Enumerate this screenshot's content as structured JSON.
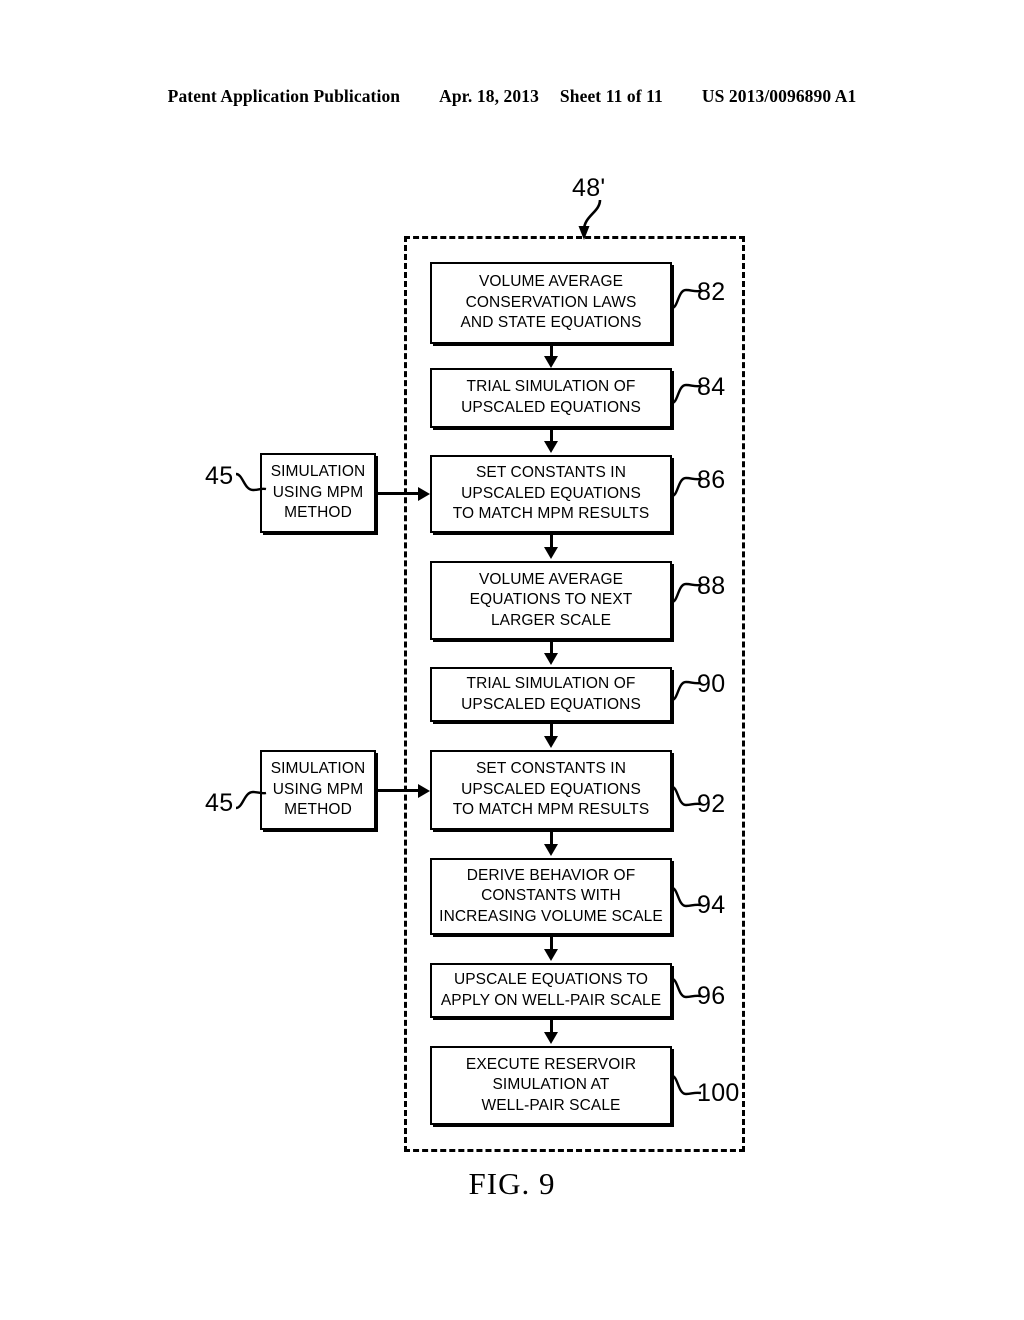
{
  "header": {
    "publication": "Patent Application Publication",
    "date": "Apr. 18, 2013",
    "sheet": "Sheet 11 of 11",
    "docnum": "US 2013/0096890 A1"
  },
  "figure": {
    "caption": "FIG. 9",
    "container_ref": "48'",
    "boxes": [
      {
        "ref": "82",
        "lines": [
          "VOLUME AVERAGE",
          "CONSERVATION LAWS",
          "AND STATE EQUATIONS"
        ]
      },
      {
        "ref": "84",
        "lines": [
          "TRIAL SIMULATION OF",
          "UPSCALED EQUATIONS"
        ]
      },
      {
        "ref": "86",
        "lines": [
          "SET CONSTANTS IN",
          "UPSCALED EQUATIONS",
          "TO MATCH MPM RESULTS"
        ]
      },
      {
        "ref": "88",
        "lines": [
          "VOLUME AVERAGE",
          "EQUATIONS TO NEXT",
          "LARGER SCALE"
        ]
      },
      {
        "ref": "90",
        "lines": [
          "TRIAL SIMULATION OF",
          "UPSCALED EQUATIONS"
        ]
      },
      {
        "ref": "92",
        "lines": [
          "SET CONSTANTS IN",
          "UPSCALED EQUATIONS",
          "TO MATCH MPM RESULTS"
        ]
      },
      {
        "ref": "94",
        "lines": [
          "DERIVE BEHAVIOR OF",
          "CONSTANTS WITH",
          "INCREASING VOLUME SCALE"
        ]
      },
      {
        "ref": "96",
        "lines": [
          "UPSCALE EQUATIONS TO",
          "APPLY ON WELL-PAIR SCALE"
        ]
      },
      {
        "ref": "100",
        "lines": [
          "EXECUTE RESERVOIR",
          "SIMULATION AT",
          "WELL-PAIR SCALE"
        ]
      }
    ],
    "side_boxes": [
      {
        "ref": "45",
        "lines": [
          "SIMULATION",
          "USING MPM",
          "METHOD"
        ]
      },
      {
        "ref": "45",
        "lines": [
          "SIMULATION",
          "USING MPM",
          "METHOD"
        ]
      }
    ]
  },
  "colors": {
    "ink": "#000000",
    "paper": "#ffffff"
  }
}
